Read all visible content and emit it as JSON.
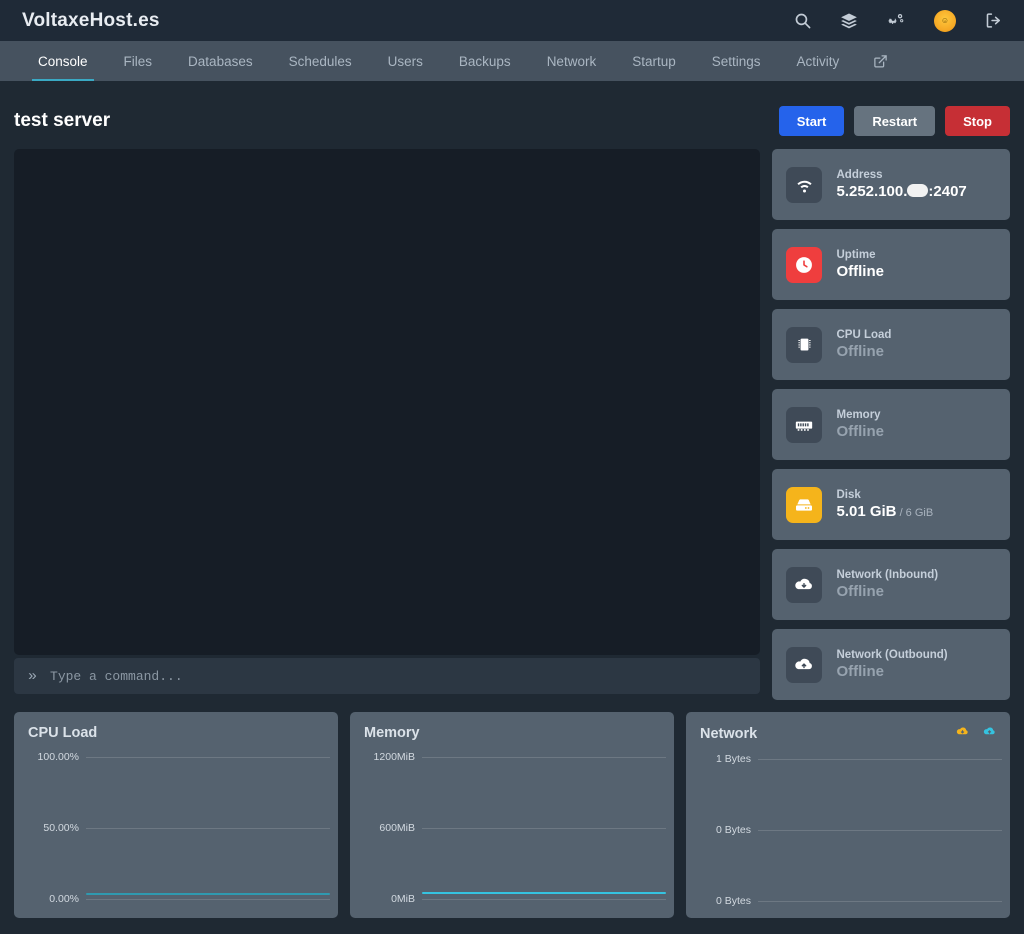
{
  "topbar": {
    "brand": "VoltaxeHost.es",
    "icons": [
      {
        "name": "search-icon",
        "label": "Search"
      },
      {
        "name": "layers-icon",
        "label": "Servers"
      },
      {
        "name": "cogs-icon",
        "label": "Admin"
      },
      {
        "name": "avatar",
        "label": "Account"
      },
      {
        "name": "logout-icon",
        "label": "Sign Out"
      }
    ]
  },
  "nav": {
    "tabs": [
      {
        "label": "Console",
        "active": true
      },
      {
        "label": "Files",
        "active": false
      },
      {
        "label": "Databases",
        "active": false
      },
      {
        "label": "Schedules",
        "active": false
      },
      {
        "label": "Users",
        "active": false
      },
      {
        "label": "Backups",
        "active": false
      },
      {
        "label": "Network",
        "active": false
      },
      {
        "label": "Startup",
        "active": false
      },
      {
        "label": "Settings",
        "active": false
      },
      {
        "label": "Activity",
        "active": false
      }
    ],
    "external_link_icon": "external-link-icon",
    "active_underline_color": "#3aa9c4"
  },
  "header": {
    "server_name": "test server",
    "buttons": [
      {
        "label": "Start",
        "color": "#2563eb"
      },
      {
        "label": "Restart",
        "color": "#66737f"
      },
      {
        "label": "Stop",
        "color": "#c62f35"
      }
    ]
  },
  "console": {
    "output": "",
    "prompt": "»",
    "placeholder": "Type a command..."
  },
  "stats": [
    {
      "icon": "wifi-icon",
      "icon_color": "#3f4a57",
      "label": "Address",
      "value_prefix": "5.252.100.",
      "redacted": true,
      "value_suffix": ":2407",
      "offline": false
    },
    {
      "icon": "clock-icon",
      "icon_color": "#ef3e3e",
      "label": "Uptime",
      "value": "Offline",
      "offline": false
    },
    {
      "icon": "microchip-icon",
      "icon_color": "#3f4a57",
      "label": "CPU Load",
      "value": "Offline",
      "offline": true
    },
    {
      "icon": "memory-icon",
      "icon_color": "#3f4a57",
      "label": "Memory",
      "value": "Offline",
      "offline": true
    },
    {
      "icon": "hdd-icon",
      "icon_color": "#f5b41b",
      "label": "Disk",
      "value": "5.01 GiB",
      "sub": " / 6 GiB",
      "offline": false
    },
    {
      "icon": "cloud-download-icon",
      "icon_color": "#3f4a57",
      "label": "Network (Inbound)",
      "value": "Offline",
      "offline": true
    },
    {
      "icon": "cloud-upload-icon",
      "icon_color": "#3f4a57",
      "label": "Network (Outbound)",
      "value": "Offline",
      "offline": true
    }
  ],
  "chart_data": [
    {
      "type": "line",
      "title": "CPU Load",
      "ylabel": "",
      "xlabel": "",
      "ticks": [
        "100.00%",
        "50.00%",
        "0.00%"
      ],
      "ylim": [
        0,
        100
      ],
      "grid": true,
      "legend": [],
      "series": [
        {
          "name": "CPU Load",
          "color": "#35c3e0",
          "values": [
            0,
            0,
            0,
            0,
            0,
            0,
            0,
            0,
            0,
            0
          ]
        }
      ]
    },
    {
      "type": "line",
      "title": "Memory",
      "ylabel": "",
      "xlabel": "",
      "ticks": [
        "1200MiB",
        "600MiB",
        "0MiB"
      ],
      "ylim": [
        0,
        1200
      ],
      "grid": true,
      "legend": [],
      "series": [
        {
          "name": "Memory",
          "color": "#35c3e0",
          "values": [
            0,
            0,
            0,
            0,
            0,
            0,
            0,
            0,
            0,
            0
          ]
        }
      ]
    },
    {
      "type": "line",
      "title": "Network",
      "ylabel": "",
      "xlabel": "",
      "ticks": [
        "1 Bytes",
        "0 Bytes",
        "0 Bytes"
      ],
      "ylim": [
        0,
        1
      ],
      "grid": true,
      "legend": [
        {
          "name": "cloud-download-icon",
          "color": "#f5b41b"
        },
        {
          "name": "cloud-upload-icon",
          "color": "#35c3e0"
        }
      ],
      "series": []
    }
  ]
}
